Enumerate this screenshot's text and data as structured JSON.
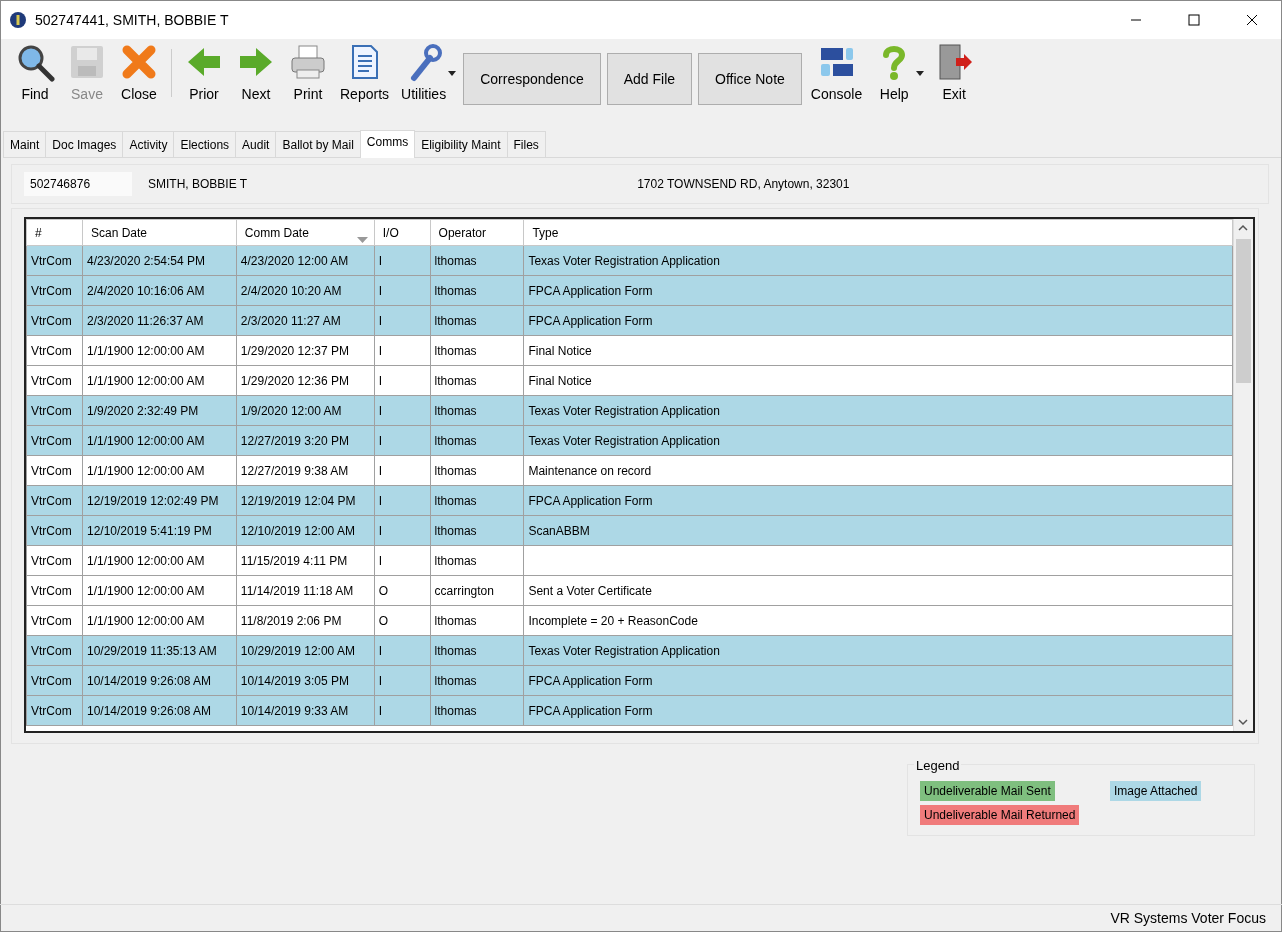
{
  "window": {
    "title": "502747441, SMITH, BOBBIE T"
  },
  "toolbar": [
    {
      "kind": "tool",
      "label": "Find",
      "disabled": false,
      "dropdown": false
    },
    {
      "kind": "tool",
      "label": "Save",
      "disabled": true,
      "dropdown": false
    },
    {
      "kind": "tool",
      "label": "Close",
      "disabled": false,
      "dropdown": false
    },
    {
      "kind": "separator"
    },
    {
      "kind": "tool",
      "label": "Prior",
      "disabled": false,
      "dropdown": false
    },
    {
      "kind": "tool",
      "label": "Next",
      "disabled": false,
      "dropdown": false
    },
    {
      "kind": "tool",
      "label": "Print",
      "disabled": false,
      "dropdown": false
    },
    {
      "kind": "tool",
      "label": "Reports",
      "disabled": false,
      "dropdown": false
    },
    {
      "kind": "tool",
      "label": "Utilities",
      "disabled": false,
      "dropdown": true
    },
    {
      "kind": "button",
      "label": "Correspondence"
    },
    {
      "kind": "button",
      "label": "Add File"
    },
    {
      "kind": "button",
      "label": "Office Note"
    },
    {
      "kind": "tool",
      "label": "Console",
      "disabled": false,
      "dropdown": false
    },
    {
      "kind": "tool",
      "label": "Help",
      "disabled": false,
      "dropdown": true
    },
    {
      "kind": "tool",
      "label": "Exit",
      "disabled": false,
      "dropdown": false
    }
  ],
  "tabs": [
    {
      "label": "Maint",
      "selected": false
    },
    {
      "label": "Doc Images",
      "selected": false
    },
    {
      "label": "Activity",
      "selected": false
    },
    {
      "label": "Elections",
      "selected": false
    },
    {
      "label": "Audit",
      "selected": false
    },
    {
      "label": "Ballot by Mail",
      "selected": false
    },
    {
      "label": "Comms",
      "selected": true
    },
    {
      "label": "Eligibility Maint",
      "selected": false
    },
    {
      "label": "Files",
      "selected": false
    }
  ],
  "voter": {
    "id": "502746876",
    "name": "SMITH, BOBBIE T",
    "address": "1702 TOWNSEND RD, Anytown, 32301"
  },
  "table": {
    "columns": [
      {
        "label": "#",
        "sorted": false
      },
      {
        "label": "Scan Date",
        "sorted": false
      },
      {
        "label": "Comm Date",
        "sorted": true
      },
      {
        "label": "I/O",
        "sorted": false
      },
      {
        "label": "Operator",
        "sorted": false
      },
      {
        "label": "Type",
        "sorted": false
      }
    ],
    "rows": [
      {
        "color": "#add8e6",
        "cells": [
          "VtrCom",
          "4/23/2020 2:54:54 PM",
          "4/23/2020 12:00 AM",
          "I",
          "lthomas",
          "Texas Voter Registration Application"
        ]
      },
      {
        "color": "#add8e6",
        "cells": [
          "VtrCom",
          "2/4/2020 10:16:06 AM",
          "2/4/2020 10:20 AM",
          "I",
          "lthomas",
          "FPCA Application Form"
        ]
      },
      {
        "color": "#add8e6",
        "cells": [
          "VtrCom",
          "2/3/2020 11:26:37 AM",
          "2/3/2020 11:27 AM",
          "I",
          "lthomas",
          "FPCA Application Form"
        ]
      },
      {
        "color": "#ffffff",
        "cells": [
          "VtrCom",
          "1/1/1900 12:00:00 AM",
          "1/29/2020 12:37 PM",
          "I",
          "lthomas",
          "Final Notice"
        ]
      },
      {
        "color": "#ffffff",
        "cells": [
          "VtrCom",
          "1/1/1900 12:00:00 AM",
          "1/29/2020 12:36 PM",
          "I",
          "lthomas",
          "Final Notice"
        ]
      },
      {
        "color": "#add8e6",
        "cells": [
          "VtrCom",
          "1/9/2020 2:32:49 PM",
          "1/9/2020 12:00 AM",
          "I",
          "lthomas",
          "Texas Voter Registration Application"
        ]
      },
      {
        "color": "#add8e6",
        "cells": [
          "VtrCom",
          "1/1/1900 12:00:00 AM",
          "12/27/2019 3:20 PM",
          "I",
          "lthomas",
          "Texas Voter Registration Application"
        ]
      },
      {
        "color": "#ffffff",
        "cells": [
          "VtrCom",
          "1/1/1900 12:00:00 AM",
          "12/27/2019 9:38 AM",
          "I",
          "lthomas",
          "Maintenance on record"
        ]
      },
      {
        "color": "#add8e6",
        "cells": [
          "VtrCom",
          "12/19/2019 12:02:49 PM",
          "12/19/2019 12:04 PM",
          "I",
          "lthomas",
          "FPCA Application Form"
        ]
      },
      {
        "color": "#add8e6",
        "cells": [
          "VtrCom",
          "12/10/2019 5:41:19 PM",
          "12/10/2019 12:00 AM",
          "I",
          "lthomas",
          "ScanABBM"
        ]
      },
      {
        "color": "#ffffff",
        "cells": [
          "VtrCom",
          "1/1/1900 12:00:00 AM",
          "11/15/2019 4:11 PM",
          "I",
          "lthomas",
          ""
        ]
      },
      {
        "color": "#ffffff",
        "cells": [
          "VtrCom",
          "1/1/1900 12:00:00 AM",
          "11/14/2019 11:18 AM",
          "O",
          "ccarrington",
          "Sent a Voter Certificate"
        ]
      },
      {
        "color": "#ffffff",
        "cells": [
          "VtrCom",
          "1/1/1900 12:00:00 AM",
          "11/8/2019 2:06 PM",
          "O",
          "lthomas",
          "Incomplete = 20 + ReasonCode"
        ]
      },
      {
        "color": "#add8e6",
        "cells": [
          "VtrCom",
          "10/29/2019 11:35:13 AM",
          "10/29/2019 12:00 AM",
          "I",
          "lthomas",
          "Texas Voter Registration Application"
        ]
      },
      {
        "color": "#add8e6",
        "cells": [
          "VtrCom",
          "10/14/2019 9:26:08 AM",
          "10/14/2019 3:05 PM",
          "I",
          "lthomas",
          "FPCA Application Form"
        ]
      },
      {
        "color": "#add8e6",
        "cells": [
          "VtrCom",
          "10/14/2019 9:26:08 AM",
          "10/14/2019 9:33 AM",
          "I",
          "lthomas",
          "FPCA Application Form"
        ]
      }
    ]
  },
  "legend": {
    "title": "Legend",
    "items": [
      {
        "label": "Undeliverable Mail Sent",
        "color": "#7fbf7f"
      },
      {
        "label": "Image Attached",
        "color": "#add8e6"
      },
      {
        "label": "Undeliverable Mail Returned",
        "color": "#f07b7b"
      }
    ]
  },
  "status_bar": {
    "text": "VR Systems Voter Focus"
  }
}
